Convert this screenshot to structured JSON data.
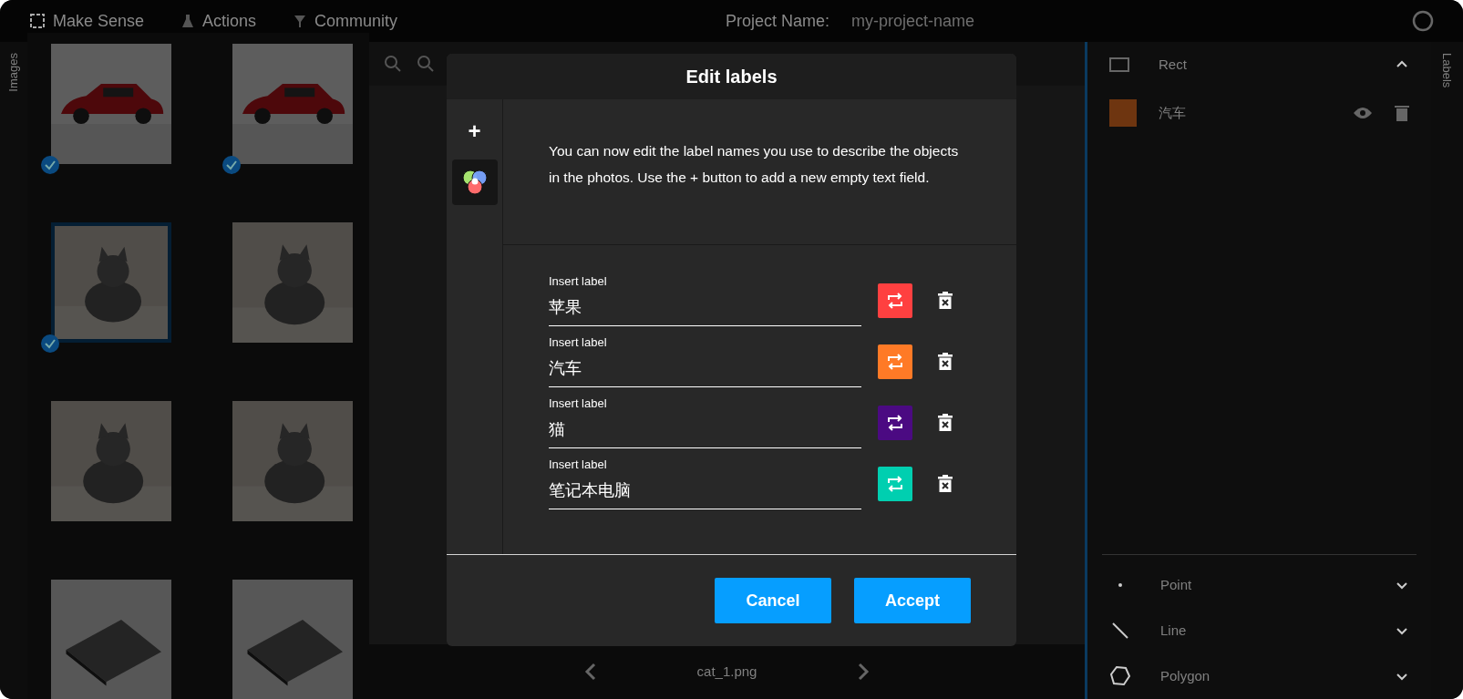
{
  "topbar": {
    "logo": "Make Sense",
    "menu": [
      "Actions",
      "Community"
    ],
    "project_label": "Project Name:",
    "project_name": "my-project-name"
  },
  "left_tab": "Images",
  "images": [
    {
      "checked": true,
      "selected": false
    },
    {
      "checked": true,
      "selected": false
    },
    {
      "checked": true,
      "selected": true
    },
    {
      "checked": false,
      "selected": false
    },
    {
      "checked": false,
      "selected": false
    },
    {
      "checked": false,
      "selected": false
    },
    {
      "checked": false,
      "selected": false
    },
    {
      "checked": false,
      "selected": false
    }
  ],
  "editor": {
    "filename": "cat_1.png"
  },
  "right_panel": {
    "tool": "Rect",
    "expanded": true,
    "labels": [
      {
        "name": "汽车",
        "color": "#6e3510"
      }
    ],
    "tools": [
      "Point",
      "Line",
      "Polygon"
    ]
  },
  "right_tab": "Labels",
  "modal": {
    "title": "Edit labels",
    "add_button": "+",
    "description": "You can now edit the label names you use to describe the objects in the photos. Use the + button to add a new empty text field.",
    "labels": [
      {
        "caption": "Insert label",
        "value": "苹果",
        "color": "#ff4040"
      },
      {
        "caption": "Insert label",
        "value": "汽车",
        "color": "#ff7a26"
      },
      {
        "caption": "Insert label",
        "value": "猫",
        "color": "#4b0a82"
      },
      {
        "caption": "Insert label",
        "value": "笔记本电脑",
        "color": "#00cfb0"
      }
    ],
    "buttons": [
      "Cancel",
      "Accept"
    ]
  }
}
